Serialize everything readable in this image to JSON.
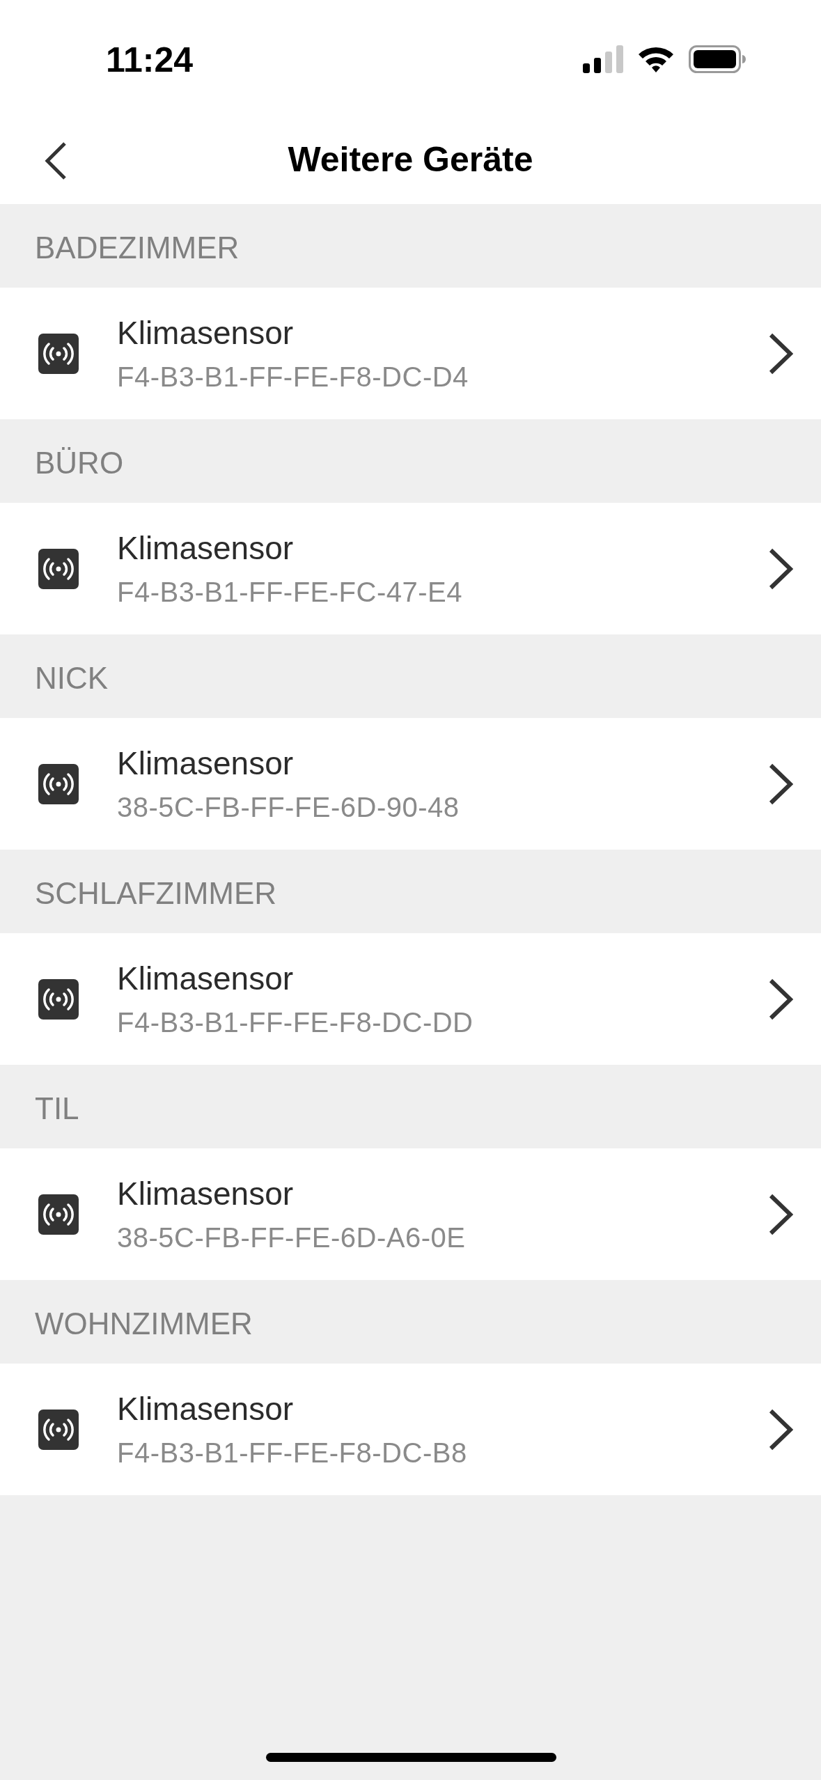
{
  "status_bar": {
    "time": "11:24"
  },
  "nav": {
    "title": "Weitere Geräte"
  },
  "sections": [
    {
      "header": "BADEZIMMER",
      "devices": [
        {
          "name": "Klimasensor",
          "address": "F4-B3-B1-FF-FE-F8-DC-D4"
        }
      ]
    },
    {
      "header": "BÜRO",
      "devices": [
        {
          "name": "Klimasensor",
          "address": "F4-B3-B1-FF-FE-FC-47-E4"
        }
      ]
    },
    {
      "header": "NICK",
      "devices": [
        {
          "name": "Klimasensor",
          "address": "38-5C-FB-FF-FE-6D-90-48"
        }
      ]
    },
    {
      "header": "SCHLAFZIMMER",
      "devices": [
        {
          "name": "Klimasensor",
          "address": "F4-B3-B1-FF-FE-F8-DC-DD"
        }
      ]
    },
    {
      "header": "TIL",
      "devices": [
        {
          "name": "Klimasensor",
          "address": "38-5C-FB-FF-FE-6D-A6-0E"
        }
      ]
    },
    {
      "header": "WOHNZIMMER",
      "devices": [
        {
          "name": "Klimasensor",
          "address": "F4-B3-B1-FF-FE-F8-DC-B8"
        }
      ]
    }
  ]
}
